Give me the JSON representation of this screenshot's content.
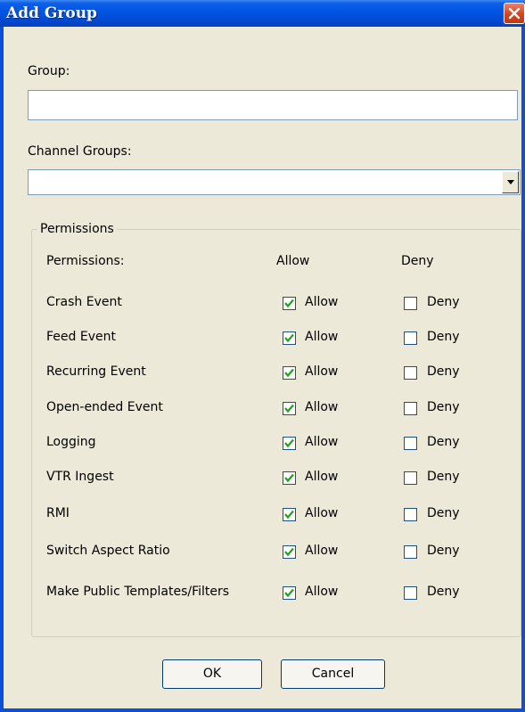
{
  "window": {
    "title": "Add Group"
  },
  "group": {
    "label": "Group:",
    "value": ""
  },
  "channel_groups": {
    "label": "Channel Groups:",
    "selected": ""
  },
  "permissions": {
    "legend": "Permissions",
    "header": {
      "name": "Permissions:",
      "allow": "Allow",
      "deny": "Deny"
    },
    "rows": [
      {
        "name": "Crash Event",
        "allow_label": "Allow",
        "deny_label": "Deny",
        "allow": true,
        "deny": false
      },
      {
        "name": "Feed Event",
        "allow_label": "Allow",
        "deny_label": "Deny",
        "allow": true,
        "deny": false
      },
      {
        "name": "Recurring Event",
        "allow_label": "Allow",
        "deny_label": "Deny",
        "allow": true,
        "deny": false
      },
      {
        "name": "Open-ended Event",
        "allow_label": "Allow",
        "deny_label": "Deny",
        "allow": true,
        "deny": false
      },
      {
        "name": "Logging",
        "allow_label": "Allow",
        "deny_label": "Deny",
        "allow": true,
        "deny": false
      },
      {
        "name": "VTR Ingest",
        "allow_label": "Allow",
        "deny_label": "Deny",
        "allow": true,
        "deny": false
      },
      {
        "name": "RMI",
        "allow_label": "Allow",
        "deny_label": "Deny",
        "allow": true,
        "deny": false
      },
      {
        "name": "Switch Aspect Ratio",
        "allow_label": "Allow",
        "deny_label": "Deny",
        "allow": true,
        "deny": false
      },
      {
        "name": "Make Public Templates/Filters",
        "allow_label": "Allow",
        "deny_label": "Deny",
        "allow": true,
        "deny": false
      }
    ]
  },
  "buttons": {
    "ok": "OK",
    "cancel": "Cancel"
  }
}
